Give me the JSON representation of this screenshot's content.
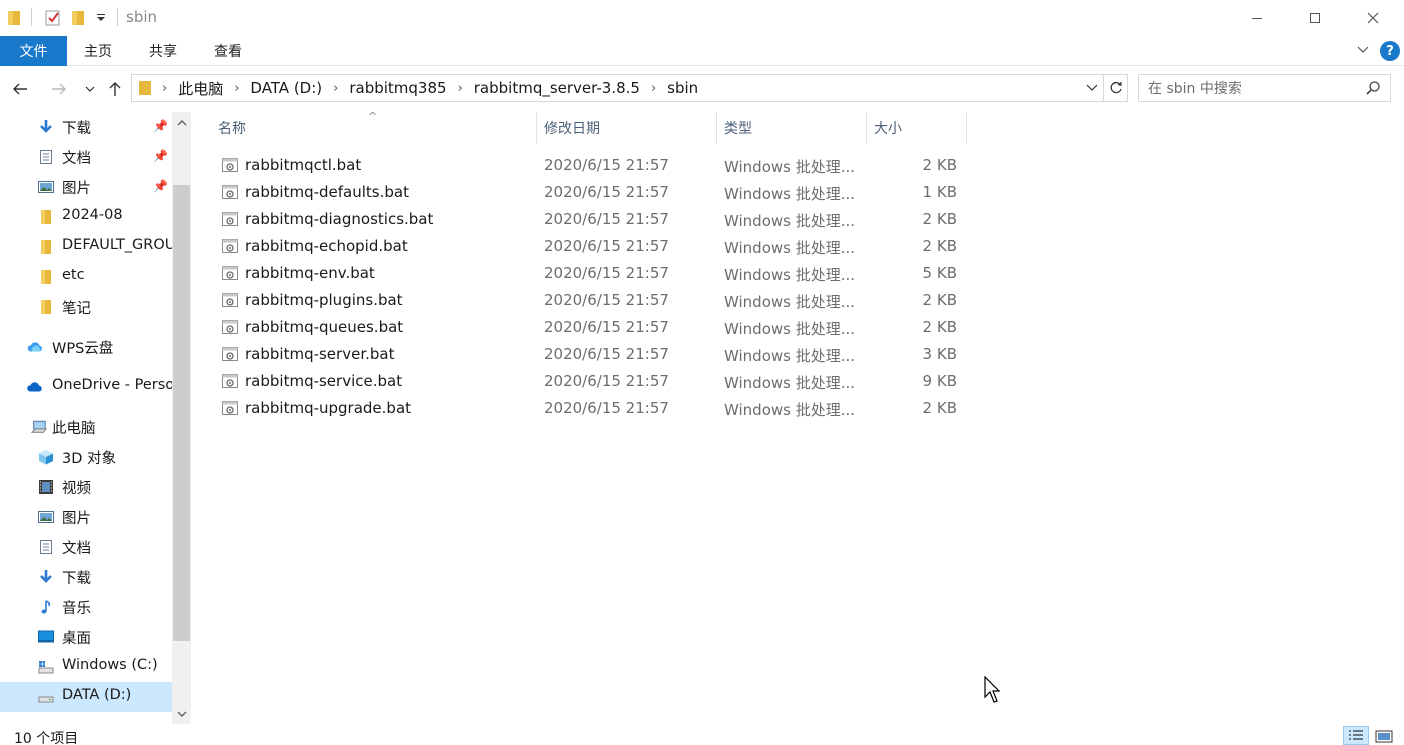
{
  "window": {
    "title": "sbin",
    "controls": [
      "minimize-icon",
      "maximize-icon",
      "close-icon"
    ]
  },
  "ribbon": {
    "file_tab": "文件",
    "tabs": [
      "主页",
      "共享",
      "查看"
    ],
    "accent_color": "#1979ca"
  },
  "address": {
    "crumbs": [
      "此电脑",
      "DATA (D:)",
      "rabbitmq385",
      "rabbitmq_server-3.8.5",
      "sbin"
    ],
    "search_placeholder": "在 sbin 中搜索"
  },
  "sidebar": {
    "items": [
      {
        "label": "下载",
        "icon": "download-arrow-icon",
        "pinned": true
      },
      {
        "label": "文档",
        "icon": "document-icon",
        "pinned": true
      },
      {
        "label": "图片",
        "icon": "pictures-icon",
        "pinned": true
      },
      {
        "label": "2024-08",
        "icon": "folder-icon",
        "pinned": false
      },
      {
        "label": "DEFAULT_GROU",
        "icon": "folder-icon",
        "pinned": false
      },
      {
        "label": "etc",
        "icon": "folder-icon",
        "pinned": false
      },
      {
        "label": "笔记",
        "icon": "folder-icon",
        "pinned": false
      },
      {
        "label": "WPS云盘",
        "icon": "cloud-icon",
        "pinned": false
      },
      {
        "label": "OneDrive - Perso",
        "icon": "onedrive-cloud-icon",
        "pinned": false
      },
      {
        "label": "此电脑",
        "icon": "computer-icon",
        "pinned": false
      },
      {
        "label": "3D 对象",
        "icon": "3d-objects-icon",
        "pinned": false
      },
      {
        "label": "视频",
        "icon": "video-icon",
        "pinned": false
      },
      {
        "label": "图片",
        "icon": "pictures-icon",
        "pinned": false
      },
      {
        "label": "文档",
        "icon": "document-icon",
        "pinned": false
      },
      {
        "label": "下载",
        "icon": "download-arrow-icon",
        "pinned": false
      },
      {
        "label": "音乐",
        "icon": "music-note-icon",
        "pinned": false
      },
      {
        "label": "桌面",
        "icon": "desktop-icon",
        "pinned": false
      },
      {
        "label": "Windows (C:)",
        "icon": "drive-icon",
        "pinned": false
      },
      {
        "label": "DATA (D:)",
        "icon": "drive-icon",
        "pinned": false,
        "selected": true
      }
    ]
  },
  "columns": {
    "name": "名称",
    "date": "修改日期",
    "type": "类型",
    "size": "大小"
  },
  "files": [
    {
      "name": "rabbitmqctl.bat",
      "date": "2020/6/15 21:57",
      "type": "Windows 批处理...",
      "size": "2 KB"
    },
    {
      "name": "rabbitmq-defaults.bat",
      "date": "2020/6/15 21:57",
      "type": "Windows 批处理...",
      "size": "1 KB"
    },
    {
      "name": "rabbitmq-diagnostics.bat",
      "date": "2020/6/15 21:57",
      "type": "Windows 批处理...",
      "size": "2 KB"
    },
    {
      "name": "rabbitmq-echopid.bat",
      "date": "2020/6/15 21:57",
      "type": "Windows 批处理...",
      "size": "2 KB"
    },
    {
      "name": "rabbitmq-env.bat",
      "date": "2020/6/15 21:57",
      "type": "Windows 批处理...",
      "size": "5 KB"
    },
    {
      "name": "rabbitmq-plugins.bat",
      "date": "2020/6/15 21:57",
      "type": "Windows 批处理...",
      "size": "2 KB"
    },
    {
      "name": "rabbitmq-queues.bat",
      "date": "2020/6/15 21:57",
      "type": "Windows 批处理...",
      "size": "2 KB"
    },
    {
      "name": "rabbitmq-server.bat",
      "date": "2020/6/15 21:57",
      "type": "Windows 批处理...",
      "size": "3 KB"
    },
    {
      "name": "rabbitmq-service.bat",
      "date": "2020/6/15 21:57",
      "type": "Windows 批处理...",
      "size": "9 KB"
    },
    {
      "name": "rabbitmq-upgrade.bat",
      "date": "2020/6/15 21:57",
      "type": "Windows 批处理...",
      "size": "2 KB"
    }
  ],
  "status": {
    "item_count": "10 个项目"
  }
}
